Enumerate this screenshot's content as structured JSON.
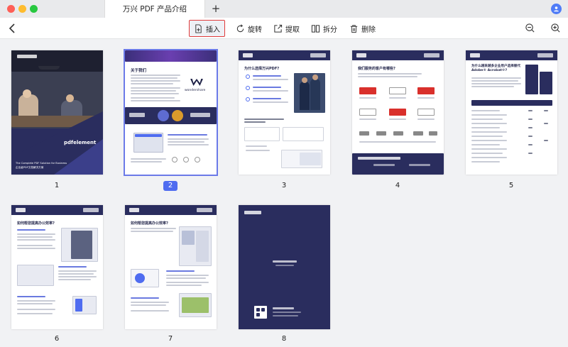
{
  "window": {
    "tab_title": "万兴 PDF 产品介绍",
    "new_tab": "+"
  },
  "toolbar": {
    "insert": "插入",
    "rotate": "旋转",
    "extract": "提取",
    "split": "拆分",
    "delete": "删除"
  },
  "pages": [
    {
      "number": "1",
      "title": "The Complete PDF Solution for Business",
      "brand": "pdfelement",
      "cn": "企业级PDF文档解决方案"
    },
    {
      "number": "2",
      "title": "关于我们",
      "selected": true
    },
    {
      "number": "3",
      "title": "为什么选择万兴PDF?"
    },
    {
      "number": "4",
      "title": "我们服务的客户有哪些?"
    },
    {
      "number": "5",
      "title": "为什么越来越多企业用户选择替代 Adobe® Acrobat®?"
    },
    {
      "number": "6",
      "title": "如何帮您提高办公效率?"
    },
    {
      "number": "7",
      "title": "如何帮您提高办公效率?"
    },
    {
      "number": "8",
      "title": ""
    }
  ],
  "colors": {
    "accent": "#4f6cf0",
    "navy": "#2a2d5e",
    "highlight": "#e03b3b"
  }
}
